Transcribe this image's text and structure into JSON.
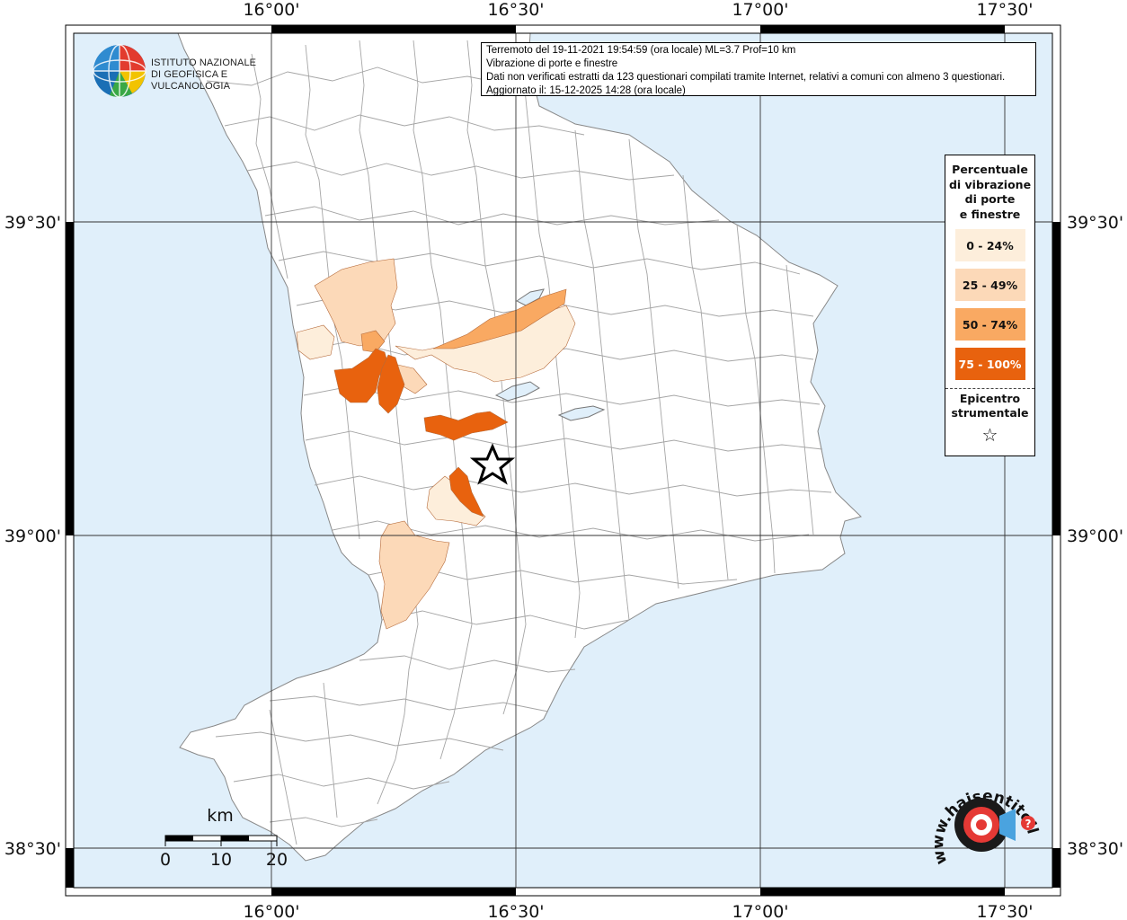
{
  "info": {
    "line1": "Terremoto del 19-11-2021 19:54:59 (ora locale) ML=3.7 Prof=10 km",
    "line2": "Vibrazione di porte e finestre",
    "line3": "Dati non verificati estratti da 123 questionari compilati tramite Internet, relativi a comuni con almeno 3 questionari.",
    "line4": "Aggiornato il: 15-12-2025 14:28 (ora locale)"
  },
  "logo_ingv": {
    "line1": "ISTITUTO NAZIONALE",
    "line2": "DI GEOFISICA E VULCANOLOGIA"
  },
  "legend": {
    "title1": "Percentuale",
    "title2": "di vibrazione",
    "title3": "di porte",
    "title4": "e finestre",
    "classes": [
      {
        "label": "0 - 24%",
        "color": "#fdeedb"
      },
      {
        "label": "25 - 49%",
        "color": "#fcd9b8"
      },
      {
        "label": "50 - 74%",
        "color": "#f9a962"
      },
      {
        "label": "75 - 100%",
        "color": "#e8620e"
      }
    ],
    "epicenter1": "Epicentro",
    "epicenter2": "strumentale",
    "star": "☆"
  },
  "axes": {
    "top": [
      "16°00'",
      "16°30'",
      "17°00'",
      "17°30'"
    ],
    "bottom": [
      "16°00'",
      "16°30'",
      "17°00'",
      "17°30'"
    ],
    "left": [
      "39°30'",
      "39°00'",
      "38°30'"
    ],
    "right": [
      "39°30'",
      "39°00'",
      "38°30'"
    ]
  },
  "scale": {
    "unit": "km",
    "ticks": [
      "0",
      "10",
      "20"
    ]
  },
  "logo_hst": {
    "text": "www.haisentitoilterremoto.it"
  },
  "colors": {
    "sea": "#e0effa",
    "land": "#ffffff",
    "border_line": "#9a9a9a",
    "grid": "#333333"
  }
}
